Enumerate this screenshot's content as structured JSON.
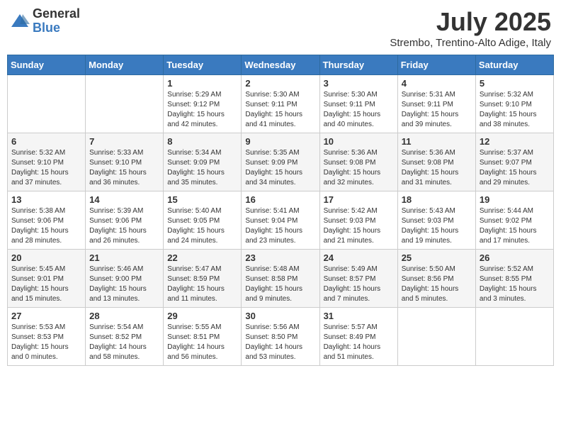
{
  "header": {
    "logo_general": "General",
    "logo_blue": "Blue",
    "month_year": "July 2025",
    "location": "Strembo, Trentino-Alto Adige, Italy"
  },
  "weekdays": [
    "Sunday",
    "Monday",
    "Tuesday",
    "Wednesday",
    "Thursday",
    "Friday",
    "Saturday"
  ],
  "weeks": [
    [
      {
        "day": "",
        "detail": ""
      },
      {
        "day": "",
        "detail": ""
      },
      {
        "day": "1",
        "detail": "Sunrise: 5:29 AM\nSunset: 9:12 PM\nDaylight: 15 hours\nand 42 minutes."
      },
      {
        "day": "2",
        "detail": "Sunrise: 5:30 AM\nSunset: 9:11 PM\nDaylight: 15 hours\nand 41 minutes."
      },
      {
        "day": "3",
        "detail": "Sunrise: 5:30 AM\nSunset: 9:11 PM\nDaylight: 15 hours\nand 40 minutes."
      },
      {
        "day": "4",
        "detail": "Sunrise: 5:31 AM\nSunset: 9:11 PM\nDaylight: 15 hours\nand 39 minutes."
      },
      {
        "day": "5",
        "detail": "Sunrise: 5:32 AM\nSunset: 9:10 PM\nDaylight: 15 hours\nand 38 minutes."
      }
    ],
    [
      {
        "day": "6",
        "detail": "Sunrise: 5:32 AM\nSunset: 9:10 PM\nDaylight: 15 hours\nand 37 minutes."
      },
      {
        "day": "7",
        "detail": "Sunrise: 5:33 AM\nSunset: 9:10 PM\nDaylight: 15 hours\nand 36 minutes."
      },
      {
        "day": "8",
        "detail": "Sunrise: 5:34 AM\nSunset: 9:09 PM\nDaylight: 15 hours\nand 35 minutes."
      },
      {
        "day": "9",
        "detail": "Sunrise: 5:35 AM\nSunset: 9:09 PM\nDaylight: 15 hours\nand 34 minutes."
      },
      {
        "day": "10",
        "detail": "Sunrise: 5:36 AM\nSunset: 9:08 PM\nDaylight: 15 hours\nand 32 minutes."
      },
      {
        "day": "11",
        "detail": "Sunrise: 5:36 AM\nSunset: 9:08 PM\nDaylight: 15 hours\nand 31 minutes."
      },
      {
        "day": "12",
        "detail": "Sunrise: 5:37 AM\nSunset: 9:07 PM\nDaylight: 15 hours\nand 29 minutes."
      }
    ],
    [
      {
        "day": "13",
        "detail": "Sunrise: 5:38 AM\nSunset: 9:06 PM\nDaylight: 15 hours\nand 28 minutes."
      },
      {
        "day": "14",
        "detail": "Sunrise: 5:39 AM\nSunset: 9:06 PM\nDaylight: 15 hours\nand 26 minutes."
      },
      {
        "day": "15",
        "detail": "Sunrise: 5:40 AM\nSunset: 9:05 PM\nDaylight: 15 hours\nand 24 minutes."
      },
      {
        "day": "16",
        "detail": "Sunrise: 5:41 AM\nSunset: 9:04 PM\nDaylight: 15 hours\nand 23 minutes."
      },
      {
        "day": "17",
        "detail": "Sunrise: 5:42 AM\nSunset: 9:03 PM\nDaylight: 15 hours\nand 21 minutes."
      },
      {
        "day": "18",
        "detail": "Sunrise: 5:43 AM\nSunset: 9:03 PM\nDaylight: 15 hours\nand 19 minutes."
      },
      {
        "day": "19",
        "detail": "Sunrise: 5:44 AM\nSunset: 9:02 PM\nDaylight: 15 hours\nand 17 minutes."
      }
    ],
    [
      {
        "day": "20",
        "detail": "Sunrise: 5:45 AM\nSunset: 9:01 PM\nDaylight: 15 hours\nand 15 minutes."
      },
      {
        "day": "21",
        "detail": "Sunrise: 5:46 AM\nSunset: 9:00 PM\nDaylight: 15 hours\nand 13 minutes."
      },
      {
        "day": "22",
        "detail": "Sunrise: 5:47 AM\nSunset: 8:59 PM\nDaylight: 15 hours\nand 11 minutes."
      },
      {
        "day": "23",
        "detail": "Sunrise: 5:48 AM\nSunset: 8:58 PM\nDaylight: 15 hours\nand 9 minutes."
      },
      {
        "day": "24",
        "detail": "Sunrise: 5:49 AM\nSunset: 8:57 PM\nDaylight: 15 hours\nand 7 minutes."
      },
      {
        "day": "25",
        "detail": "Sunrise: 5:50 AM\nSunset: 8:56 PM\nDaylight: 15 hours\nand 5 minutes."
      },
      {
        "day": "26",
        "detail": "Sunrise: 5:52 AM\nSunset: 8:55 PM\nDaylight: 15 hours\nand 3 minutes."
      }
    ],
    [
      {
        "day": "27",
        "detail": "Sunrise: 5:53 AM\nSunset: 8:53 PM\nDaylight: 15 hours\nand 0 minutes."
      },
      {
        "day": "28",
        "detail": "Sunrise: 5:54 AM\nSunset: 8:52 PM\nDaylight: 14 hours\nand 58 minutes."
      },
      {
        "day": "29",
        "detail": "Sunrise: 5:55 AM\nSunset: 8:51 PM\nDaylight: 14 hours\nand 56 minutes."
      },
      {
        "day": "30",
        "detail": "Sunrise: 5:56 AM\nSunset: 8:50 PM\nDaylight: 14 hours\nand 53 minutes."
      },
      {
        "day": "31",
        "detail": "Sunrise: 5:57 AM\nSunset: 8:49 PM\nDaylight: 14 hours\nand 51 minutes."
      },
      {
        "day": "",
        "detail": ""
      },
      {
        "day": "",
        "detail": ""
      }
    ]
  ]
}
